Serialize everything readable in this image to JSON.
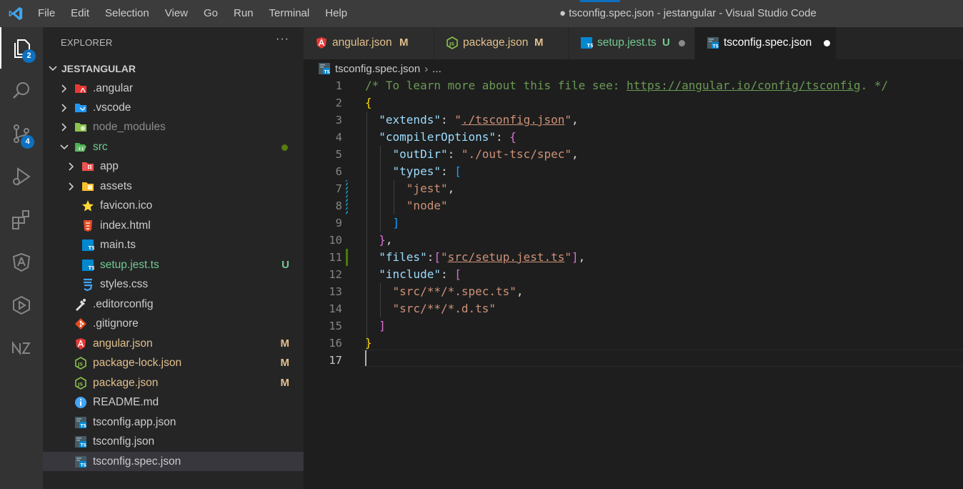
{
  "window": {
    "title": "● tsconfig.spec.json - jestangular - Visual Studio Code",
    "menu": [
      "File",
      "Edit",
      "Selection",
      "View",
      "Go",
      "Run",
      "Terminal",
      "Help"
    ]
  },
  "activity_bar": {
    "explorer_badge": "2",
    "source_control_badge": "4"
  },
  "explorer": {
    "header": "EXPLORER",
    "more": "···",
    "root": "JESTANGULAR",
    "items": [
      {
        "name": ".angular",
        "status": ""
      },
      {
        "name": ".vscode",
        "status": ""
      },
      {
        "name": "node_modules",
        "status": ""
      },
      {
        "name": "src",
        "status": ""
      },
      {
        "name": "app",
        "status": ""
      },
      {
        "name": "assets",
        "status": ""
      },
      {
        "name": "favicon.ico",
        "status": ""
      },
      {
        "name": "index.html",
        "status": ""
      },
      {
        "name": "main.ts",
        "status": ""
      },
      {
        "name": "setup.jest.ts",
        "status": "U"
      },
      {
        "name": "styles.css",
        "status": ""
      },
      {
        "name": ".editorconfig",
        "status": ""
      },
      {
        "name": ".gitignore",
        "status": ""
      },
      {
        "name": "angular.json",
        "status": "M"
      },
      {
        "name": "package-lock.json",
        "status": "M"
      },
      {
        "name": "package.json",
        "status": "M"
      },
      {
        "name": "README.md",
        "status": ""
      },
      {
        "name": "tsconfig.app.json",
        "status": ""
      },
      {
        "name": "tsconfig.json",
        "status": ""
      },
      {
        "name": "tsconfig.spec.json",
        "status": ""
      }
    ]
  },
  "tabs": [
    {
      "name": "angular.json",
      "status": "M"
    },
    {
      "name": "package.json",
      "status": "M"
    },
    {
      "name": "setup.jest.ts",
      "status": "U"
    },
    {
      "name": "tsconfig.spec.json",
      "status": ""
    }
  ],
  "breadcrumb": {
    "file": "tsconfig.spec.json",
    "more": "..."
  },
  "editor": {
    "line_numbers": [
      "1",
      "2",
      "3",
      "4",
      "5",
      "6",
      "7",
      "8",
      "9",
      "10",
      "11",
      "12",
      "13",
      "14",
      "15",
      "16",
      "17"
    ],
    "tokens": {
      "l1_comment": "/* To learn more about this file see: ",
      "l1_link": "https://angular.io/config/tsconfig",
      "l1_end": ". */",
      "l2_open": "{",
      "l3_key": "\"extends\"",
      "l3_sep": ": ",
      "l3_q1": "\"",
      "l3_val": "./tsconfig.json",
      "l3_q2": "\"",
      "l3_comma": ",",
      "l4_key": "\"compilerOptions\"",
      "l4_sep": ": ",
      "l4_open": "{",
      "l5_key": "\"outDir\"",
      "l5_sep": ": ",
      "l5_val": "\"./out-tsc/spec\"",
      "l5_comma": ",",
      "l6_key": "\"types\"",
      "l6_sep": ": ",
      "l6_open": "[",
      "l7_val": "\"jest\"",
      "l7_comma": ",",
      "l8_val": "\"node\"",
      "l9_close": "]",
      "l10_close": "}",
      "l10_comma": ",",
      "l11_key": "\"files\"",
      "l11_sep": ":",
      "l11_open": "[",
      "l11_q1": "\"",
      "l11_val": "src/setup.jest.ts",
      "l11_q2": "\"",
      "l11_close": "]",
      "l11_comma": ",",
      "l12_key": "\"include\"",
      "l12_sep": ": ",
      "l12_open": "[",
      "l13_val": "\"src/**/*.spec.ts\"",
      "l13_comma": ",",
      "l14_val": "\"src/**/*.d.ts\"",
      "l15_close": "]",
      "l16_close": "}"
    }
  },
  "colors": {
    "modified": "#e2c08d",
    "untracked": "#73c991",
    "badge": "#0e70c0"
  }
}
